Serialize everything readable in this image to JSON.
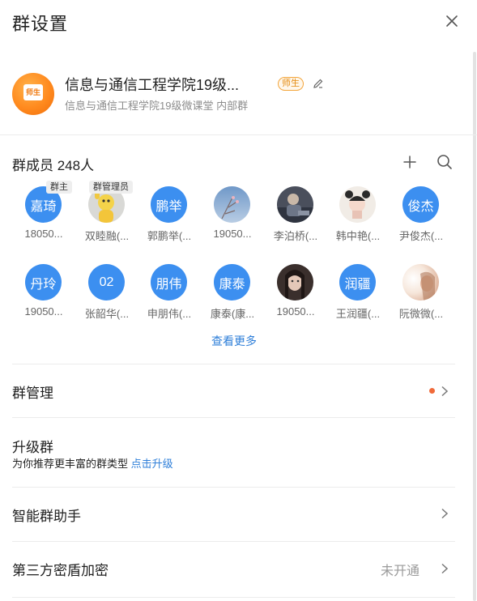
{
  "header": {
    "title": "群设置"
  },
  "group": {
    "avatar_text": "师生",
    "name": "信息与通信工程学院19级...",
    "tag": "师生",
    "subtitle": "信息与通信工程学院19级微课堂  内部群"
  },
  "members": {
    "title": "群成员 248人",
    "roles": {
      "owner": "群主",
      "admin": "群管理员"
    },
    "list": [
      {
        "avatar_text": "嘉琦",
        "name": "18050...",
        "photo": false
      },
      {
        "avatar_text": "",
        "name": "双睦融(...",
        "photo": true
      },
      {
        "avatar_text": "鹏举",
        "name": "郭鹏举(...",
        "photo": false
      },
      {
        "avatar_text": "",
        "name": "19050...",
        "photo": true
      },
      {
        "avatar_text": "",
        "name": "李泊桥(...",
        "photo": true
      },
      {
        "avatar_text": "",
        "name": "韩中艳(...",
        "photo": true
      },
      {
        "avatar_text": "俊杰",
        "name": "尹俊杰(...",
        "photo": false
      },
      {
        "avatar_text": "丹玲",
        "name": "19050...",
        "photo": false
      },
      {
        "avatar_text": "02",
        "name": "张韶华(...",
        "photo": false
      },
      {
        "avatar_text": "朋伟",
        "name": "申朋伟(...",
        "photo": false
      },
      {
        "avatar_text": "康泰",
        "name": "康泰(康...",
        "photo": false
      },
      {
        "avatar_text": "",
        "name": "19050...",
        "photo": true
      },
      {
        "avatar_text": "润疆",
        "name": "王润疆(...",
        "photo": false
      },
      {
        "avatar_text": "",
        "name": "阮微微(...",
        "photo": true
      }
    ],
    "more_label": "查看更多"
  },
  "settings": {
    "manage": {
      "label": "群管理"
    },
    "upgrade": {
      "label": "升级群",
      "desc": "为你推荐更丰富的群类型",
      "link": "点击升级"
    },
    "assistant": {
      "label": "智能群助手"
    },
    "encrypt": {
      "label": "第三方密盾加密",
      "status": "未开通"
    }
  },
  "colors": {
    "accent": "#3c8ff0",
    "link": "#2f7fd9",
    "notify_dot": "#f06a3a",
    "tag_orange": "#e48a10"
  }
}
